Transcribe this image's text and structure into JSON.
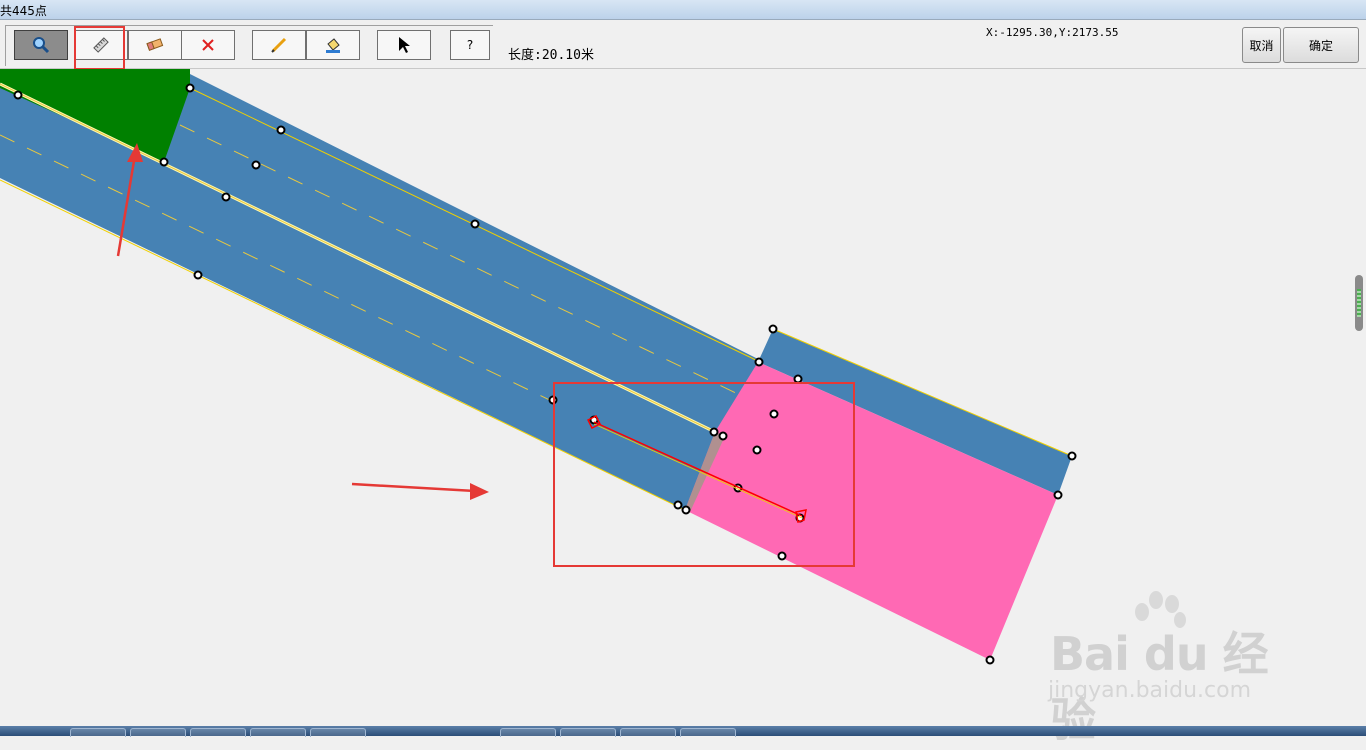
{
  "window": {
    "title": "共445点"
  },
  "toolbar": {
    "buttons": [
      {
        "name": "zoom-button",
        "icon": "magnifier-icon",
        "pressed": true
      },
      {
        "name": "measure-button",
        "icon": "ruler-icon",
        "pressed": false
      },
      {
        "name": "eraser-button",
        "icon": "eraser-icon",
        "pressed": false
      },
      {
        "name": "delete-button",
        "icon": "red-x-icon",
        "pressed": false
      },
      {
        "name": "draw-button",
        "icon": "pencil-icon",
        "pressed": false
      },
      {
        "name": "fill-button",
        "icon": "fill-bucket-icon",
        "pressed": false
      },
      {
        "name": "select-button",
        "icon": "arrow-cursor-icon",
        "pressed": false
      },
      {
        "name": "help-button",
        "label": "?",
        "pressed": false
      }
    ],
    "measure_text": "长度:20.10米",
    "coords_text": "X:-1295.30,Y:2173.55"
  },
  "dialog": {
    "cancel_label": "取消",
    "ok_label": "确定"
  },
  "map": {
    "colors": {
      "road": "#4682b4",
      "road_edge": "#f0d000",
      "lane_dash": "#e8c840",
      "green_area": "#008000",
      "pink_area": "#ff69b4",
      "measure_line": "#ff0000",
      "highlight": "#e53935",
      "background": "#f0f0f0"
    }
  },
  "watermark": {
    "brand": "Bai du 经验",
    "url": "jingyan.baidu.com"
  }
}
